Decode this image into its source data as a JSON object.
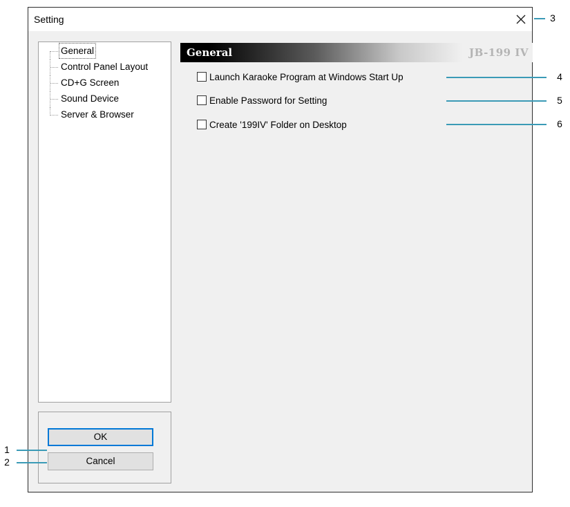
{
  "window": {
    "title": "Setting"
  },
  "tree": {
    "items": [
      {
        "label": "General",
        "selected": true
      },
      {
        "label": "Control Panel Layout"
      },
      {
        "label": "CD+G Screen"
      },
      {
        "label": "Sound Device"
      },
      {
        "label": "Server & Browser"
      }
    ]
  },
  "panel": {
    "title": "General",
    "brand": "JB-199 IV",
    "options": [
      {
        "label": "Launch Karaoke Program at Windows Start Up",
        "checked": false
      },
      {
        "label": "Enable Password for Setting",
        "checked": false
      },
      {
        "label": "Create '199IV' Folder on Desktop",
        "checked": false
      }
    ]
  },
  "buttons": {
    "ok": "OK",
    "cancel": "Cancel"
  },
  "callouts": [
    "1",
    "2",
    "3",
    "4",
    "5",
    "6"
  ],
  "colors": {
    "callout": "#3a9ab6",
    "default_button_border": "#0078d7"
  }
}
